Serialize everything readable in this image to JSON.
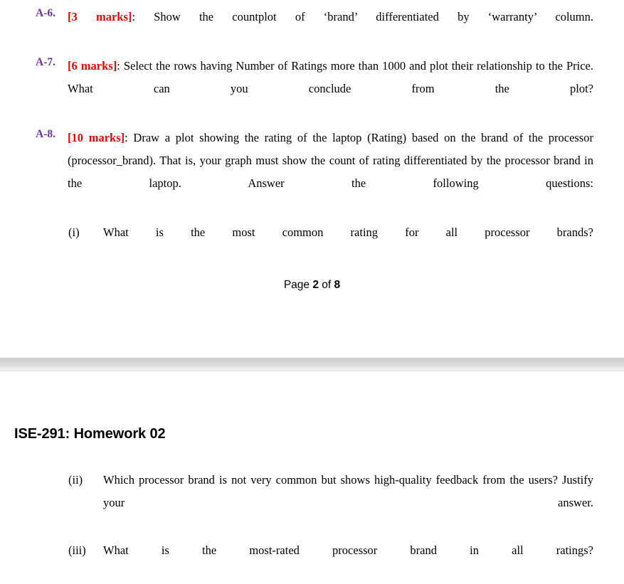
{
  "document": {
    "header_title": "ISE-291: Homework 02",
    "footer": {
      "prefix": "Page",
      "current": "2",
      "middle": "of",
      "total": "8"
    }
  },
  "colors": {
    "question_label": "#7030A0",
    "marks": "#EE0000",
    "body_text": "#000000",
    "page_background": "#ffffff",
    "page_gap": "#d2d2d2"
  },
  "page_one": {
    "questions": [
      {
        "label": "A-6.",
        "marks": "[3 marks]",
        "text": ": Show the countplot of ‘brand’ differentiated by ‘warranty’ column."
      },
      {
        "label": "A-7.",
        "marks": "[6 marks]",
        "text": ": Select the rows having Number of Ratings more than 1000 and plot their relationship to the Price. What can you conclude from the plot?"
      },
      {
        "label": "A-8.",
        "marks": "[10 marks]",
        "text": ": Draw a plot showing the rating of the laptop (Rating) based on the brand of the processor (processor_brand). That is, your graph must show the count of rating differentiated by the processor brand in the laptop. Answer the following questions:"
      }
    ],
    "subitems": [
      {
        "label": "(i)",
        "text": "What is the most common rating for all processor brands?"
      }
    ]
  },
  "page_two": {
    "subitems": [
      {
        "label": "(ii)",
        "text": "Which processor brand is not very common but shows high-quality feedback from the users? Justify your answer."
      },
      {
        "label": "(iii)",
        "text": "What is the most-rated processor brand in all ratings?"
      }
    ]
  }
}
